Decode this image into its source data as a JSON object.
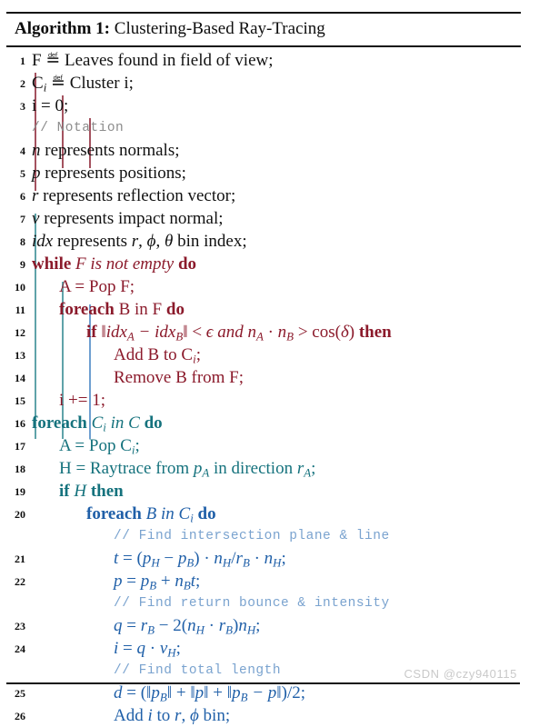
{
  "title": {
    "label": "Algorithm 1:",
    "name": "Clustering-Based Ray-Tracing"
  },
  "colors": {
    "black": "#111111",
    "maroon": "#8b1a2b",
    "teal": "#15727d",
    "blue": "#1f5fa8",
    "comment_gray": "#8c8c8c",
    "comment_blue": "#7aa3cf",
    "rule": "#111111",
    "watermark": "#c9c9c9"
  },
  "lines": [
    {
      "no": "1",
      "text": "F ≜ Leaves found in field of view;"
    },
    {
      "no": "2",
      "text": "C_i ≜ Cluster i;"
    },
    {
      "no": "3",
      "text": "i = 0;"
    },
    {
      "no": "",
      "text": "// Notation"
    },
    {
      "no": "4",
      "text": "n represents normals;"
    },
    {
      "no": "5",
      "text": "p represents positions;"
    },
    {
      "no": "6",
      "text": "r represents reflection vector;"
    },
    {
      "no": "7",
      "text": "v represents impact normal;"
    },
    {
      "no": "8",
      "text": "idx represents r, φ, θ bin index;"
    },
    {
      "no": "9",
      "text": "while F is not empty do"
    },
    {
      "no": "10",
      "text": "A = Pop F;"
    },
    {
      "no": "11",
      "text": "foreach B in F do"
    },
    {
      "no": "12",
      "text": "if ‖idx_A − idx_B‖ < ε and n_A · n_B > cos(δ) then"
    },
    {
      "no": "13",
      "text": "Add B to C_i;"
    },
    {
      "no": "14",
      "text": "Remove B from F;"
    },
    {
      "no": "15",
      "text": "i += 1;"
    },
    {
      "no": "16",
      "text": "foreach C_i in C do"
    },
    {
      "no": "17",
      "text": "A = Pop C_i;"
    },
    {
      "no": "18",
      "text": "H = Raytrace from p_A in direction r_A;"
    },
    {
      "no": "19",
      "text": "if H then"
    },
    {
      "no": "20",
      "text": "foreach B in C_i do"
    },
    {
      "no": "",
      "text": "// Find intersection plane & line"
    },
    {
      "no": "21",
      "text": "t = (p_H − p_B) · n_H / r_B · n_H;"
    },
    {
      "no": "22",
      "text": "p = p_B + n_B t;"
    },
    {
      "no": "",
      "text": "// Find return bounce & intensity"
    },
    {
      "no": "23",
      "text": "q = r_B − 2(n_H · r_B) n_H;"
    },
    {
      "no": "24",
      "text": "i = q · v_H;"
    },
    {
      "no": "",
      "text": "// Find total length"
    },
    {
      "no": "25",
      "text": "d = (‖p_B‖ + ‖p‖ + ‖p_B − p‖)/2;"
    },
    {
      "no": "26",
      "text": "Add i to r, φ bin;"
    }
  ],
  "numbers": {
    "n1": "1",
    "n2": "2",
    "n3": "3",
    "n4": "4",
    "n5": "5",
    "n6": "6",
    "n7": "7",
    "n8": "8",
    "n9": "9",
    "n10": "10",
    "n11": "11",
    "n12": "12",
    "n13": "13",
    "n14": "14",
    "n15": "15",
    "n16": "16",
    "n17": "17",
    "n18": "18",
    "n19": "19",
    "n20": "20",
    "n21": "21",
    "n22": "22",
    "n23": "23",
    "n24": "24",
    "n25": "25",
    "n26": "26"
  },
  "comments": {
    "notation": "// Notation",
    "find_plane": "// Find intersection plane & line",
    "find_bounce": "// Find return bounce & intensity",
    "find_length": "// Find total length"
  },
  "keywords": {
    "while": "while",
    "do": "do",
    "foreach": "foreach",
    "if": "if",
    "then": "then",
    "and": "and",
    "in": "in",
    "is_not_empty": "is not empty"
  },
  "watermark": "CSDN @czy940115"
}
